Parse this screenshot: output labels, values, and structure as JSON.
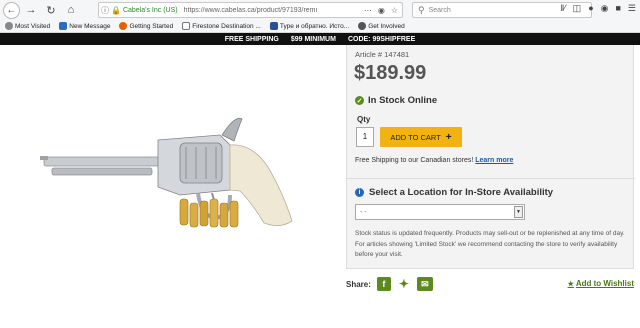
{
  "browser": {
    "url_owner": "Cabela's Inc (US)",
    "url": "https://www.cabelas.ca/product/97193/remi",
    "search_placeholder": "Search"
  },
  "bookmarks": [
    {
      "label": "Most Visited",
      "color": "#888888"
    },
    {
      "label": "New Message",
      "color": "#2b6cc4"
    },
    {
      "label": "Getting Started",
      "color": "#e66000"
    },
    {
      "label": "Firestone Destination ...",
      "color": "#444444"
    },
    {
      "label": "Туре и обратно. Исто...",
      "color": "#2a4d9c"
    },
    {
      "label": "Get Involved",
      "color": "#555555"
    }
  ],
  "promo": {
    "part1": "FREE SHIPPING",
    "part2": "$99 MINIMUM",
    "part3": "CODE: 99SHIPFREE"
  },
  "product": {
    "article": "Article # 147481",
    "price": "$189.99",
    "stock": "In Stock Online",
    "qty_label": "Qty",
    "qty_value": "1",
    "add_to_cart": "ADD TO CART",
    "shipping_text": "Free Shipping to our Canadian stores! ",
    "learn_more": "Learn more",
    "location_title": "Select a Location for In-Store Availability",
    "location_default": "- -",
    "stock_note": "Stock status is updated frequently. Products may sell-out or be replenished at any time of day. For articles showing 'Limited Stock' we recommend contacting the store to verify availability before your visit."
  },
  "share": {
    "label": "Share:",
    "wishlist": "Add to Wishlist"
  },
  "colors": {
    "accent_green": "#5c8a1e",
    "cart_yellow": "#f2b312",
    "link_blue": "#1a5ca8"
  }
}
